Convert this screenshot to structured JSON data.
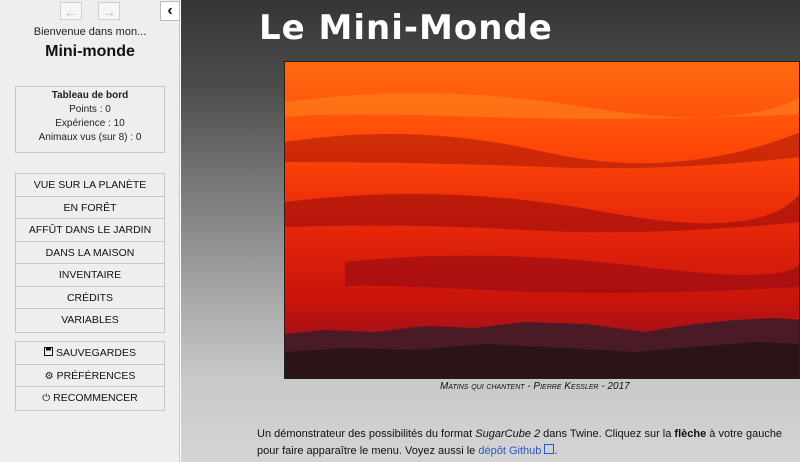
{
  "sidebar": {
    "back_icon": "←",
    "forward_icon": "→",
    "stow_icon": "‹",
    "subtitle": "Bienvenue dans mon...",
    "title": "Mini-monde",
    "dashboard": {
      "title": "Tableau de bord",
      "points": "Points : 0",
      "experience": "Expérience : 10",
      "animals": "Animaux vus (sur 8) : 0"
    },
    "story_menu": [
      "VUE SUR LA PLANÈTE",
      "EN FORÊT",
      "AFFÛT DANS LE JARDIN",
      "DANS LA MAISON",
      "INVENTAIRE",
      "CRÉDITS",
      "VARIABLES"
    ],
    "core_menu": {
      "saves": "SAUVEGARDES",
      "settings": "PRÉFÉRENCES",
      "restart": "RECOMMENCER"
    }
  },
  "main": {
    "heading": "Le Mini-Monde",
    "caption": "Matins qui chantent - Pierre Kessler - 2017",
    "intro_before": "Un démonstrateur des possibilités du format ",
    "intro_format": "SugarCube 2",
    "intro_mid": " dans Twine. Cliquez sur la ",
    "intro_bold": "flèche",
    "intro_after": " à votre gauche pour faire apparaître le menu. Voyez aussi le ",
    "intro_link": "dépôt Github",
    "intro_end": "."
  },
  "colors": {
    "sky_top": "#ff5a08",
    "sky_mid": "#d91c0a",
    "hills": "#2a1418",
    "link": "#2a57c9"
  }
}
